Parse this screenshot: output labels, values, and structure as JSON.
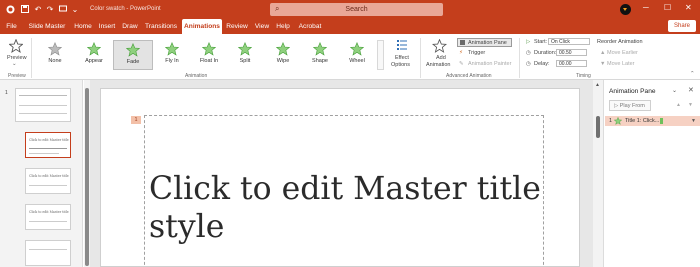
{
  "titlebar": {
    "doc_title": "Color swatch - PowerPoint",
    "search_placeholder": "Search",
    "minimize": "─",
    "maximize": "☐",
    "close": "✕"
  },
  "menu": {
    "tabs": [
      "File",
      "Slide Master",
      "Home",
      "Insert",
      "Draw",
      "Transitions",
      "Animations",
      "Review",
      "View",
      "Help",
      "Acrobat"
    ],
    "active": "Animations",
    "share": "Share"
  },
  "ribbon": {
    "preview_group": {
      "button": "Preview",
      "group_label": "Preview"
    },
    "animations_group": {
      "items": [
        "None",
        "Appear",
        "Fade",
        "Fly In",
        "Float In",
        "Split",
        "Wipe",
        "Shape",
        "Wheel"
      ],
      "selected": "Fade",
      "effect_options": [
        "Effect",
        "Options"
      ],
      "group_label": "Animation"
    },
    "advanced_group": {
      "add_animation": [
        "Add",
        "Animation"
      ],
      "animation_pane": "Animation Pane",
      "trigger": "Trigger",
      "painter": "Animation Painter",
      "group_label": "Advanced Animation"
    },
    "timing_group": {
      "start_label": "Start:",
      "start_value": "On Click",
      "duration_label": "Duration:",
      "duration_value": "00.50",
      "delay_label": "Delay:",
      "delay_value": "00.00",
      "reorder_label": "Reorder Animation",
      "move_earlier": "Move Earlier",
      "move_later": "Move Later",
      "group_label": "Timing"
    }
  },
  "slides": {
    "items": [
      {
        "number": "1",
        "title": "",
        "selected": false
      },
      {
        "number": "",
        "title": "Click to edit Master title",
        "selected": true
      },
      {
        "number": "",
        "title": "Click to edit Master title",
        "selected": false
      },
      {
        "number": "",
        "title": "Click to edit Master title",
        "selected": false
      },
      {
        "number": "",
        "title": "",
        "selected": false
      }
    ]
  },
  "slide": {
    "anim_tag": "1",
    "title": "Click to edit Master title style"
  },
  "anim_pane": {
    "title": "Animation Pane",
    "play_from": "Play From",
    "entry_index": "1",
    "entry_label": "Title 1: Click...",
    "entry_color": "#6ec05b"
  },
  "colors": {
    "accent": "#C43E1C",
    "selected_entry_bg": "#f6d1c3"
  }
}
